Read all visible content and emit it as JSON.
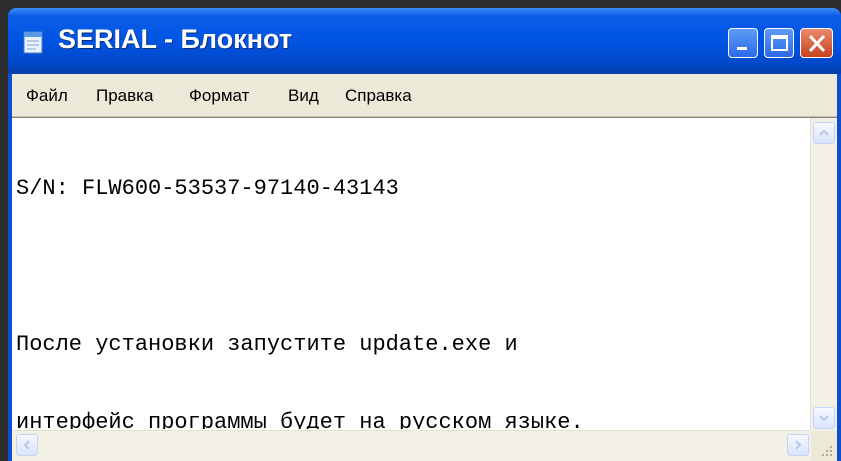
{
  "window": {
    "title": "SERIAL - Блокнот",
    "icon": "notepad-icon",
    "controls": {
      "minimize_icon": "minimize-icon",
      "maximize_icon": "maximize-icon",
      "close_icon": "close-icon"
    }
  },
  "menu": {
    "items": [
      {
        "label": "Файл"
      },
      {
        "label": "Правка"
      },
      {
        "label": "Формат"
      },
      {
        "label": "Вид"
      },
      {
        "label": "Справка"
      }
    ]
  },
  "document": {
    "lines": [
      "S/N: FLW600-53537-97140-43143",
      "",
      "После установки запустите update.exe и",
      "интерфейс программы будет на русском языке."
    ]
  },
  "colors": {
    "titlebar": "#0054e3",
    "close_button": "#c8421b",
    "menubar": "#ece9d8",
    "editor_background": "#ffffff"
  }
}
